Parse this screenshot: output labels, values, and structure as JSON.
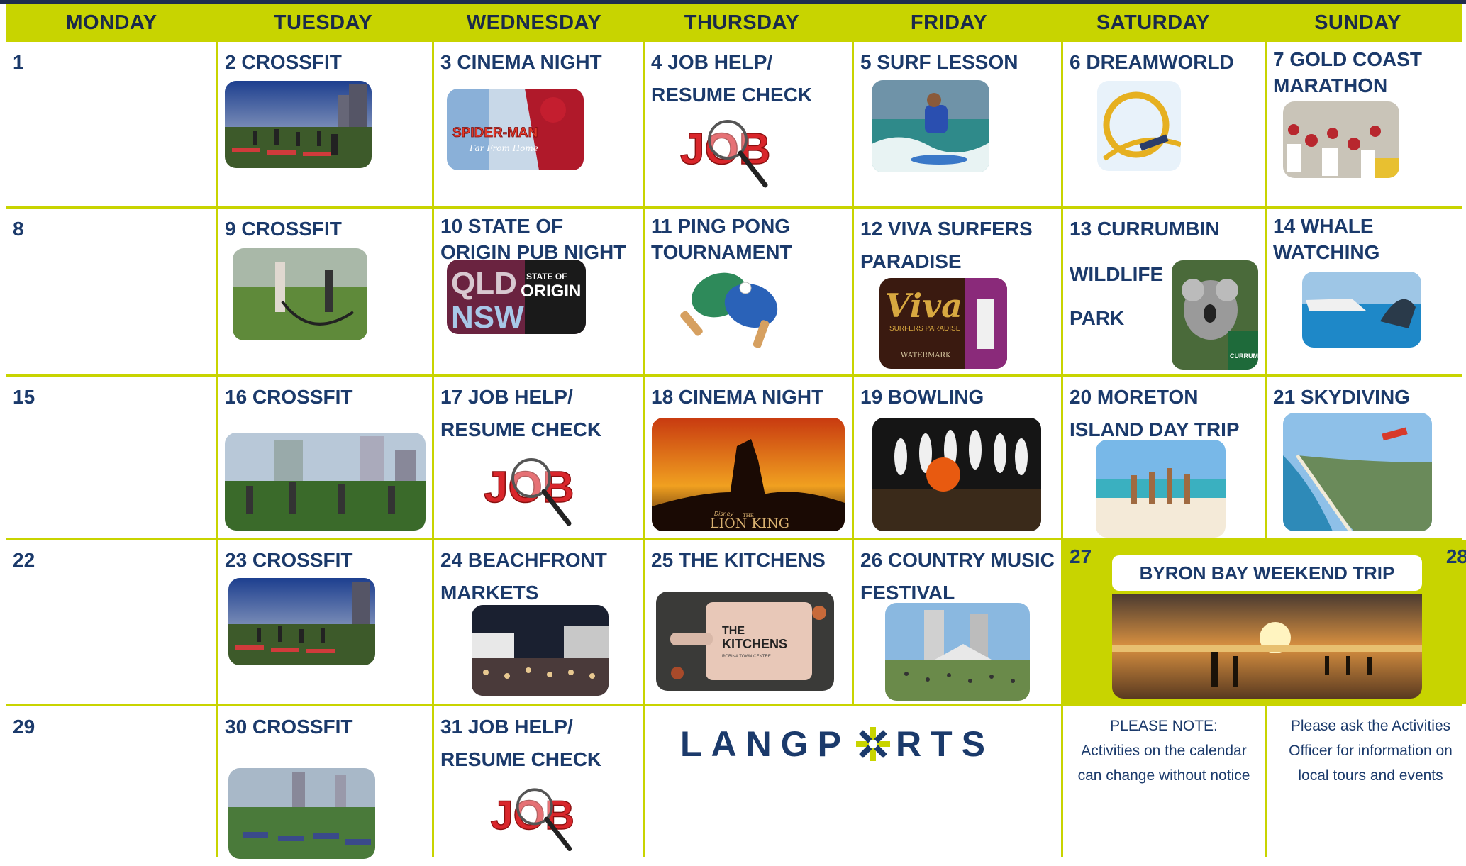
{
  "days": [
    "MONDAY",
    "TUESDAY",
    "WEDNESDAY",
    "THURSDAY",
    "FRIDAY",
    "SATURDAY",
    "SUNDAY"
  ],
  "colors": {
    "accent": "#c8d400",
    "text": "#1b3a6b",
    "header_text": "#1b2a4a"
  },
  "cells": {
    "d1": "1",
    "d2": "2 CROSSFIT",
    "d3": "3 CINEMA NIGHT",
    "d4": "4 JOB HELP/ RESUME CHECK",
    "d5": "5 SURF LESSON",
    "d6": "6 DREAMWORLD",
    "d7": "7 GOLD COAST MARATHON",
    "d8": "8",
    "d9": "9 CROSSFIT",
    "d10": "10 STATE OF ORIGIN PUB NIGHT",
    "d11": "11 PING PONG TOURNAMENT",
    "d12": "12 VIVA SURFERS PARADISE",
    "d13a": "13 CURRUMBIN",
    "d13b": "WILDLIFE",
    "d13c": "PARK",
    "d14": "14 WHALE WATCHING",
    "d15": "15",
    "d16": "16 CROSSFIT",
    "d17": "17 JOB HELP/ RESUME CHECK",
    "d18": "18 CINEMA NIGHT",
    "d19": "19 BOWLING",
    "d20": "20 MORETON ISLAND DAY TRIP",
    "d21": "21 SKYDIVING",
    "d22": "22",
    "d23": "23 CROSSFIT",
    "d24": "24 BEACHFRONT MARKETS",
    "d25": "25 THE KITCHENS",
    "d26": "26 COUNTRY MUSIC FESTIVAL",
    "d27": "27",
    "d28": "28",
    "d29": "29",
    "d30": "30 CROSSFIT",
    "d31": "31 JOB HELP/ RESUME CHECK"
  },
  "weekend_banner": "BYRON BAY WEEKEND TRIP",
  "image_labels": {
    "spiderman": "SPIDER-MAN",
    "spiderman_sub": "Far From Home",
    "job": "JOB",
    "qld": "QLD",
    "nsw": "NSW",
    "origin_top": "STATE OF",
    "origin": "ORIGIN",
    "viva": "Viva",
    "viva_sub": "SURFERS PARADISE",
    "watermark": "WATERMARK",
    "lion_king": "LION KING",
    "lion_king_the": "THE",
    "disney": "Disney",
    "kitchens_the": "THE",
    "kitchens": "KITCHENS",
    "kitchens_sub": "ROBINA TOWN CENTRE",
    "currumbin": "CURRUMBIN"
  },
  "notes": {
    "left": [
      "PLEASE NOTE:",
      "Activities on the calendar",
      "can change without notice"
    ],
    "right": [
      "Please ask the Activities",
      "Officer for information on",
      "local tours and events"
    ]
  },
  "logo": {
    "part1": "LANGP",
    "part2": "RTS"
  }
}
